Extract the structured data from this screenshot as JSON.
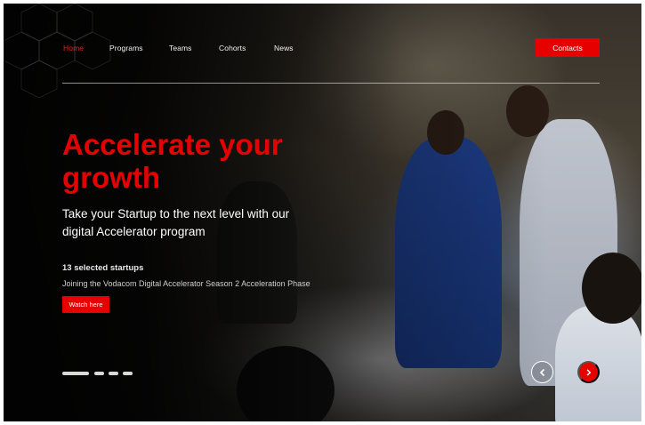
{
  "nav": {
    "items": [
      {
        "label": "Home",
        "active": true
      },
      {
        "label": "Programs",
        "active": false
      },
      {
        "label": "Teams",
        "active": false
      },
      {
        "label": "Cohorts",
        "active": false
      },
      {
        "label": "News",
        "active": false
      }
    ],
    "contacts_label": "Contacts"
  },
  "hero": {
    "title": "Accelerate your growth",
    "subtitle": "Take your Startup to the next level with our digital Accelerator program",
    "startups_count": "13 selected startups",
    "startups_desc": "Joining the Vodacom Digital Accelerator Season 2 Acceleration Phase",
    "watch_label": "Watch here"
  },
  "carousel": {
    "slide_count": 4,
    "active_slide": 1,
    "prev_icon": "chevron-left-icon",
    "next_icon": "chevron-right-icon"
  },
  "colors": {
    "accent": "#e60000",
    "text": "#ffffff"
  }
}
